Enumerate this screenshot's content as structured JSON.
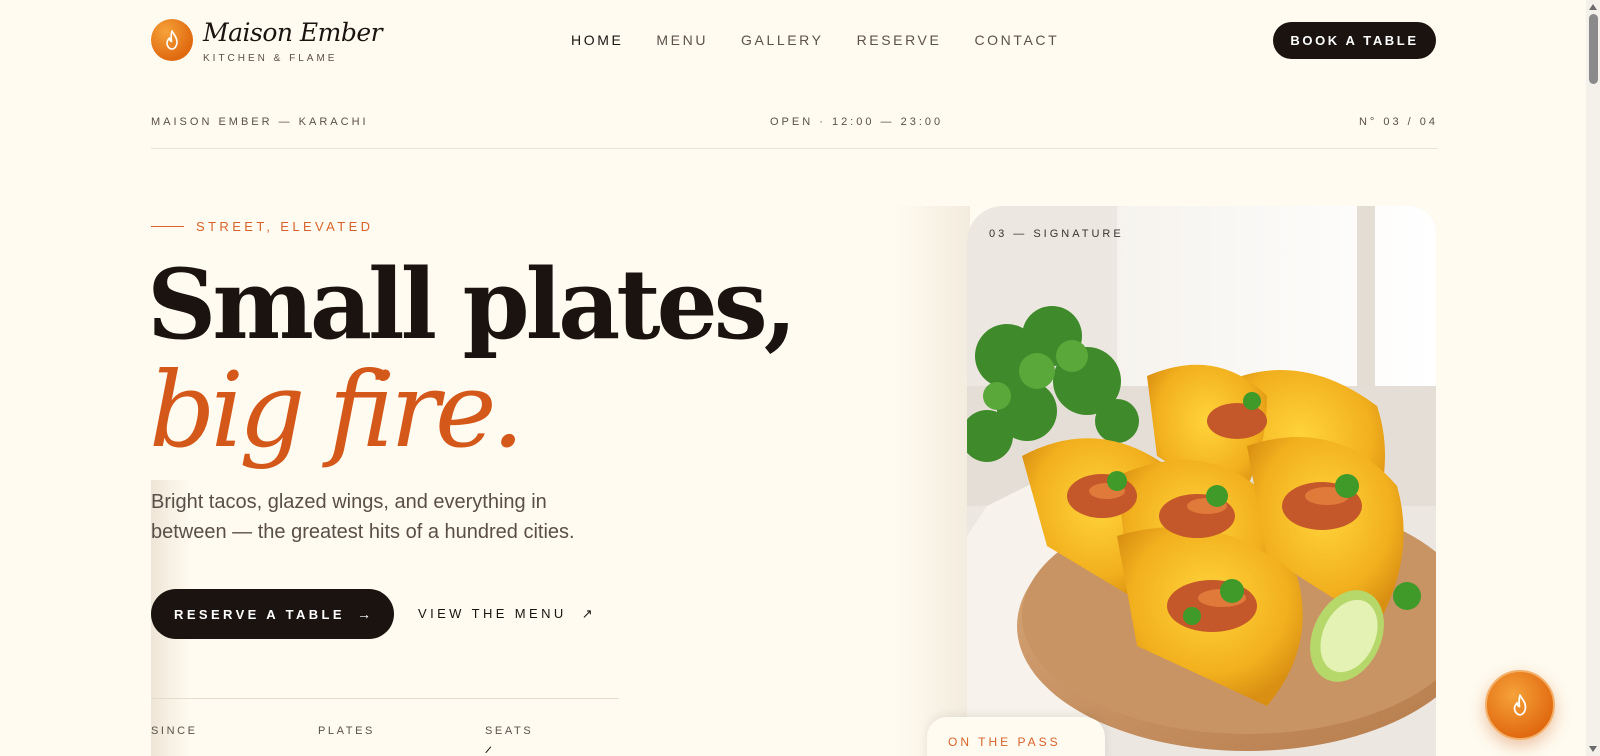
{
  "brand": {
    "name": "Maison Ember",
    "tagline": "KITCHEN & FLAME",
    "logo_icon": "flame-icon",
    "accent_color": "#e06a10"
  },
  "nav": {
    "items": [
      {
        "label": "HOME",
        "active": true
      },
      {
        "label": "MENU",
        "active": false
      },
      {
        "label": "GALLERY",
        "active": false
      },
      {
        "label": "RESERVE",
        "active": false
      },
      {
        "label": "CONTACT",
        "active": false
      }
    ],
    "cta_label": "BOOK A TABLE"
  },
  "infobar": {
    "location": "MAISON EMBER — KARACHI",
    "hours": "OPEN · 12:00 — 23:00",
    "index": "N° 03 / 04"
  },
  "hero": {
    "eyebrow": "STREET, ELEVATED",
    "headline": "Small plates,",
    "headline_accent": "big fire.",
    "lede": "Bright tacos, glazed wings, and everything in between — the greatest hits of a hundred cities.",
    "primary_cta": "RESERVE A TABLE",
    "primary_cta_icon": "arrow-right-icon",
    "secondary_cta": "VIEW THE MENU",
    "secondary_cta_icon": "arrow-up-right-icon",
    "stats": [
      {
        "label": "SINCE"
      },
      {
        "label": "PLATES"
      },
      {
        "label": "SEATS"
      }
    ]
  },
  "feature_card": {
    "label": "03 — SIGNATURE",
    "image_subject": "tacos on a wooden board with lime and cilantro",
    "tag": "ON THE PASS"
  },
  "fab": {
    "icon": "flame-icon"
  }
}
